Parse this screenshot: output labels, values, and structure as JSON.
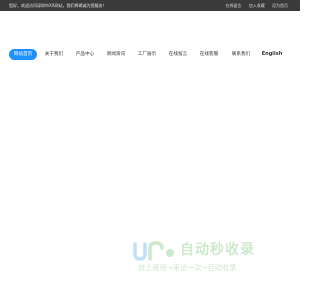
{
  "topbar": {
    "welcome": "您好，欢迎访问深圳市XX网站，我们将竭诚为您服务！",
    "links": [
      "在线留言",
      "加入收藏",
      "设为首页"
    ]
  },
  "nav": {
    "items": [
      {
        "label": "网站首页",
        "active": true
      },
      {
        "label": "关于我们"
      },
      {
        "label": "产品中心"
      },
      {
        "label": "新闻资讯"
      },
      {
        "label": "工厂展示"
      },
      {
        "label": "在线留言"
      },
      {
        "label": "在线客服"
      },
      {
        "label": "联系我们"
      },
      {
        "label": "English"
      }
    ]
  },
  "watermark": {
    "title": "自动秒收录",
    "subtitle": "放上链接→来访一次→自动收录"
  },
  "colors": {
    "topbar_bg": "#3a3a3a",
    "nav_active": "#1e90ff",
    "watermark_green": "#4caf50",
    "watermark_blue": "#2196f3"
  }
}
